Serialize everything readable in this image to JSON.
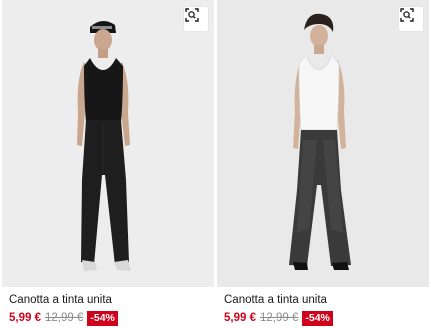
{
  "products": [
    {
      "title": "Canotta a tinta unita",
      "price": "5,99 €",
      "old_price": "12,99 €",
      "discount": "-54%",
      "image_icon": "product-photo-black-tank-top",
      "action_icon": "visual-search-icon"
    },
    {
      "title": "Canotta a tinta unita",
      "price": "5,99 €",
      "old_price": "12,99 €",
      "discount": "-54%",
      "image_icon": "product-photo-white-tank-top",
      "action_icon": "visual-search-icon"
    }
  ],
  "colors": {
    "sale": "#d0021b",
    "old_price": "#8c8c8c",
    "photo_bg": "#ededed"
  }
}
